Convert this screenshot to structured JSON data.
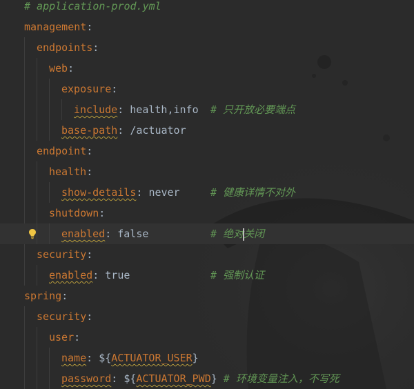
{
  "editor": {
    "file_comment": "# application-prod.yml",
    "lines": {
      "management": "management",
      "endpoints": "endpoints",
      "web": "web",
      "exposure": "exposure",
      "include_key": "include",
      "include_val": "health,info",
      "include_comment": "# 只开放必要端点",
      "base_path_key": "base-path",
      "base_path_val": "/actuator",
      "endpoint": "endpoint",
      "health": "health",
      "show_details_key": "show-details",
      "show_details_val": "never",
      "show_details_comment": "# 健康详情不对外",
      "shutdown": "shutdown",
      "enabled_key_1": "enabled",
      "enabled_val_1": "false",
      "enabled_comment_1a": "# 绝对",
      "enabled_comment_1b": "关闭",
      "security_1": "security",
      "enabled_key_2": "enabled",
      "enabled_val_2": "true",
      "enabled_comment_2": "# 强制认证",
      "spring": "spring",
      "security_2": "security",
      "user": "user",
      "name_key": "name",
      "name_val_prefix": "${",
      "name_val_var": "ACTUATOR_USER",
      "name_val_suffix": "}",
      "password_key": "password",
      "password_val_prefix": "${",
      "password_val_var": "ACTUATOR_PWD",
      "password_val_suffix": "}",
      "password_comment": "# 环境变量注入，不写死"
    },
    "colors": {
      "background": "#2b2b2b",
      "key": "#cc7832",
      "value": "#a9b7c6",
      "comment": "#629755",
      "current_line": "#323232"
    },
    "icons": {
      "intention": "lightbulb-icon"
    }
  }
}
